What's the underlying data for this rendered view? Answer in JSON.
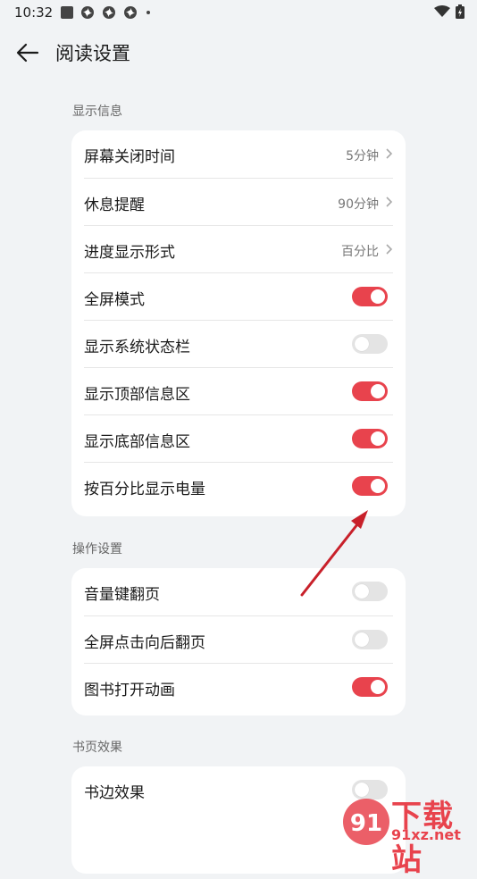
{
  "status": {
    "time": "10:32"
  },
  "header": {
    "title": "阅读设置"
  },
  "sections": [
    {
      "label": "显示信息",
      "rows": [
        {
          "label": "屏幕关闭时间",
          "value": "5分钟"
        },
        {
          "label": "休息提醒",
          "value": "90分钟"
        },
        {
          "label": "进度显示形式",
          "value": "百分比"
        },
        {
          "label": "全屏模式",
          "toggle": true
        },
        {
          "label": "显示系统状态栏",
          "toggle": false
        },
        {
          "label": "显示顶部信息区",
          "toggle": true
        },
        {
          "label": "显示底部信息区",
          "toggle": true
        },
        {
          "label": "按百分比显示电量",
          "toggle": true
        }
      ]
    },
    {
      "label": "操作设置",
      "rows": [
        {
          "label": "音量键翻页",
          "toggle": false
        },
        {
          "label": "全屏点击向后翻页",
          "toggle": false
        },
        {
          "label": "图书打开动画",
          "toggle": true
        }
      ]
    },
    {
      "label": "书页效果",
      "rows": [
        {
          "label": "书边效果",
          "toggle": false
        }
      ]
    }
  ],
  "watermark": {
    "brand": "下载站",
    "site": "91xz.net",
    "logo": "91"
  },
  "colors": {
    "accent": "#e8434d",
    "toggle_off": "#e4e4e4",
    "background": "#f1f3f5"
  }
}
